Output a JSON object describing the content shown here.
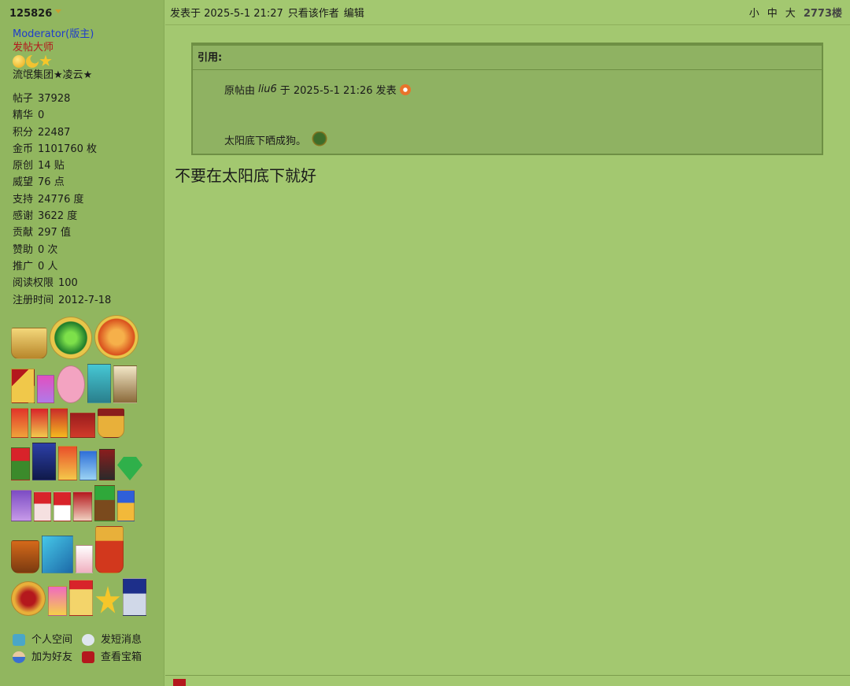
{
  "sidebar": {
    "username": "125826",
    "role": "Moderator(版主)",
    "title": "发帖大师",
    "clan": "流氓集团★凌云★",
    "stats": [
      {
        "k": "帖子",
        "v": "37928"
      },
      {
        "k": "精华",
        "v": "0"
      },
      {
        "k": "积分",
        "v": "22487"
      },
      {
        "k": "金币",
        "v": "1101760 枚"
      },
      {
        "k": "原创",
        "v": "14 贴"
      },
      {
        "k": "威望",
        "v": "76 点"
      },
      {
        "k": "支持",
        "v": "24776 度"
      },
      {
        "k": "感谢",
        "v": "3622 度"
      },
      {
        "k": "贡献",
        "v": "297 值"
      },
      {
        "k": "赞助",
        "v": "0 次"
      },
      {
        "k": "推广",
        "v": "0 人"
      },
      {
        "k": "阅读权限",
        "v": "100"
      },
      {
        "k": "注册时间",
        "v": "2012-7-18"
      }
    ],
    "links": {
      "space": "个人空间",
      "message": "发短消息",
      "friend": "加为好友",
      "treasure": "查看宝箱"
    }
  },
  "post": {
    "posted_at": "发表于 2025-5-1 21:27",
    "only_author": "只看该作者",
    "edit": "编辑",
    "size_small": "小",
    "size_mid": "中",
    "size_large": "大",
    "floor": "2773楼",
    "quote_label": "引用:",
    "quote_origin_prefix": "原帖由",
    "quote_author": "liu6",
    "quote_origin_suffix": "于 2025-5-1 21:26 发表",
    "quote_text": "太阳底下晒成狗。",
    "reply": "不要在太阳底下就好"
  },
  "colors": {
    "page_bg": "#a3c870",
    "sidebar_bg": "#91b65f",
    "quote_bg": "#8fb262",
    "moderator": "#1f3ccb",
    "title": "#b4181d"
  }
}
